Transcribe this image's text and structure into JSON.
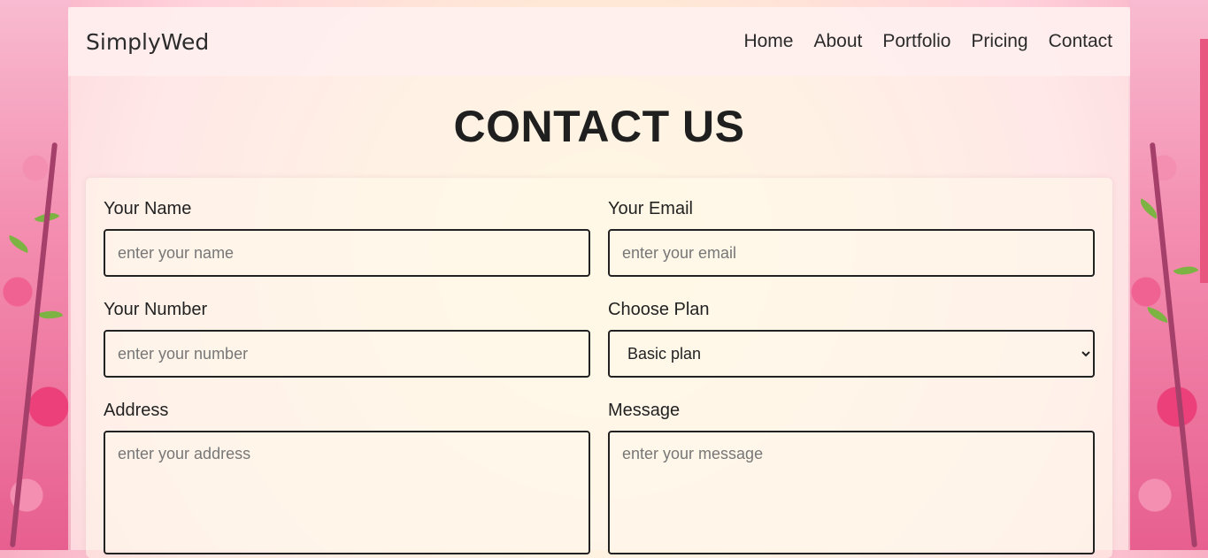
{
  "brand": "SimplyWed",
  "nav": [
    "Home",
    "About",
    "Portfolio",
    "Pricing",
    "Contact"
  ],
  "heading": "CONTACT US",
  "form": {
    "name": {
      "label": "Your Name",
      "placeholder": "enter your name"
    },
    "email": {
      "label": "Your Email",
      "placeholder": "enter your email"
    },
    "number": {
      "label": "Your Number",
      "placeholder": "enter your number"
    },
    "plan": {
      "label": "Choose Plan",
      "selected": "Basic plan"
    },
    "address": {
      "label": "Address",
      "placeholder": "enter your address"
    },
    "message": {
      "label": "Message",
      "placeholder": "enter your message"
    }
  },
  "colors": {
    "accent": "#e8557f",
    "text": "#222222",
    "border": "#222222"
  }
}
